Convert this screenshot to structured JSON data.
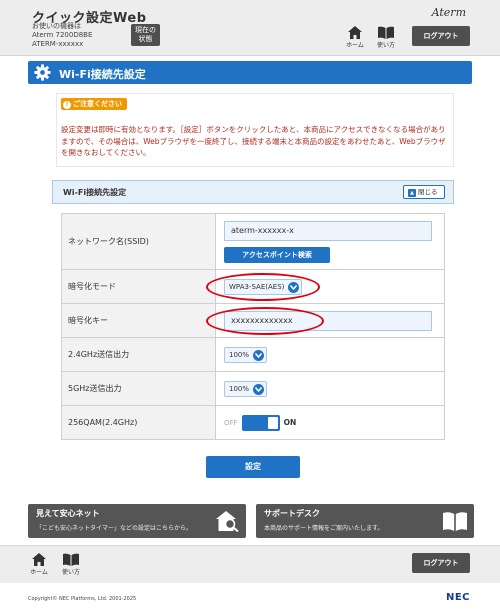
{
  "header": {
    "app_title": "クイック設定Web",
    "device_label": "お使いの機器は",
    "device_model": "Aterm 7200D8BE",
    "device_ssid": "ATERM-xxxxxx",
    "status_line1": "現在の",
    "status_line2": "状態",
    "brand": "Aterm",
    "home_label": "ホーム",
    "usage_label": "使い方",
    "logout_label": "ログアウト"
  },
  "page": {
    "title": "Wi-Fi接続先設定"
  },
  "notice": {
    "badge": "ご注意ください",
    "text": "設定変更は即時に有効となります。［設定］ボタンをクリックしたあと、本商品にアクセスできなくなる場合がありますので、その場合は、Webブラウザを一度終了し、接続する端末と本商品の設定をあわせたあと、Webブラウザを開きなおしてください。"
  },
  "section": {
    "title": "Wi-Fi接続先設定",
    "close_label": "閉じる"
  },
  "form": {
    "ssid_label": "ネットワーク名(SSID)",
    "ssid_value": "aterm-xxxxxx-x",
    "ap_search_label": "アクセスポイント検索",
    "encryption_label": "暗号化モード",
    "encryption_value": "WPA3-SAE(AES)",
    "key_label": "暗号化キー",
    "key_value": "xxxxxxxxxxxxx",
    "power24_label": "2.4GHz送信出力",
    "power24_value": "100%",
    "power5_label": "5GHz送信出力",
    "power5_value": "100%",
    "qam_label": "256QAM(2.4GHz)",
    "qam_off": "OFF",
    "qam_on": "ON"
  },
  "apply_label": "設定",
  "banners": {
    "left_title": "見えて安心ネット",
    "left_sub": "「こども安心ネットタイマー」などの設定はこちらから。",
    "right_title": "サポートデスク",
    "right_sub": "本商品のサポート情報をご案内いたします。"
  },
  "footer": {
    "home_label": "ホーム",
    "usage_label": "使い方",
    "logout_label": "ログアウト",
    "copyright": "Copyright© NEC Platforms, Ltd. 2001-2025",
    "nec": "NEC"
  },
  "colors": {
    "accent": "#1f72c4",
    "notice_text": "#b22a1e",
    "notice_badge": "#f39800",
    "highlight_ellipse": "#e00010",
    "dark_button": "#4f4f4f"
  }
}
